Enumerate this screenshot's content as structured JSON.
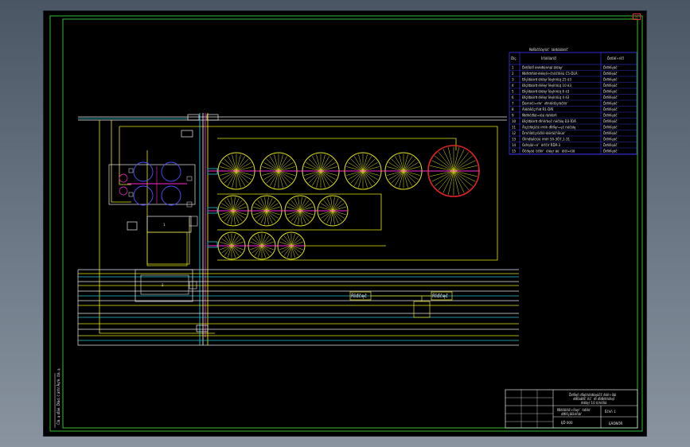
{
  "window": {
    "close_label": "×"
  },
  "colors": {
    "canvas": "#000000",
    "frame": "#2fbf2f",
    "frame_inner": "#d8d8d8",
    "pipe_yellow": "#e6e619",
    "pipe_white": "#e8e8e8",
    "pipe_cyan": "#29c4d6",
    "pipe_magenta": "#ff2bd6",
    "tank_yellow": "#e6e619",
    "tank_red": "#e02424",
    "equipment_blue": "#5050ff",
    "table_blue": "#3a3aff",
    "table_text": "#e8e8e8"
  },
  "drawing": {
    "labels": {
      "pump_left": "Ŕîđčęč",
      "pump_right": "Ŕîđčęč",
      "box_small": "1",
      "station_bottom": "2"
    }
  },
  "legend_table": {
    "title": "Ńďĺöčôčęŕöč˙ îáîđóäîâŕíč˙",
    "headers": [
      "Ďîç.",
      "Íŕčěĺíîâŕíčĺ",
      "Ďđčěĺ÷ŕíčĺ"
    ],
    "rows": [
      {
        "pos": "1",
        "name": "Ďđčĺěíîĺ óńňđîéńňâî ěîëîęŕ",
        "note": "Ďđîňĺęöč˙"
      },
      {
        "pos": "2",
        "name": "Ńĺďŕđŕňîđ-ěîëîęîî÷čńňčňĺëü Ć5-ĎĹÂ",
        "note": "Ďđîňĺęöč˙"
      },
      {
        "pos": "3",
        "name": "Đĺçĺđâóŕđ ěîëîęŕ ĺěęîńňüţ 25 ě3",
        "note": "Ďđîňĺęöč˙"
      },
      {
        "pos": "4",
        "name": "Đĺçĺđâóŕđ ěîëîęŕ ĺěęîńňüţ 10 ě3",
        "note": "Ďđîňĺęöč˙"
      },
      {
        "pos": "5",
        "name": "Đĺçĺđâóŕđ ěîëîęŕ ĺěęîńňüţ 6 ě3",
        "note": "Ďđîňĺęöč˙"
      },
      {
        "pos": "6",
        "name": "Đĺçĺđâóŕđ ěîëîęŕ ĺěęîńňüţ 4 ě3",
        "note": "Ďđîňĺęöč˙"
      },
      {
        "pos": "7",
        "name": "Ďëŕńňčí÷ŕňŕ˙ ďŕńňĺđčçŕöčîííŕ˙",
        "note": "Ďđîňĺęöč˙"
      },
      {
        "pos": "8",
        "name": "Ăîěîăĺíčçŕňîđ Ŕ1-ĎĂÍ",
        "note": "Ďđîňĺęöč˙"
      },
      {
        "pos": "9",
        "name": "Ńîđňčđîâî÷íűé ŕâňîěŕň",
        "note": "Ďđîňĺęöč˙"
      },
      {
        "pos": "10",
        "name": "Đĺçĺđâóŕđ ďîńňŕâęč ńëčâîę Đ3-ÎÓĂ",
        "note": "Ďđîňĺęöč˙"
      },
      {
        "pos": "11",
        "name": "Äîçčđóţůčé íŕńîń ďĺđĺęŕ÷ęč ńëčâîę",
        "note": "Ďđîňĺęöč˙"
      },
      {
        "pos": "12",
        "name": "Ďŕńňĺđčçŕöčîííî-îőëŕäčňĺëüíŕ˙",
        "note": "Ďđîňĺęöč˙"
      },
      {
        "pos": "13",
        "name": "Öĺíňđîáĺćíűé íŕńîń 50-3Ö7,1-31",
        "note": "Ďđîňĺęöč˙"
      },
      {
        "pos": "14",
        "name": "Óďŕęîâî÷íŕ˙ ěŕřčíŕ ŔĎÄ-3",
        "note": "Ďđîňĺęöč˙"
      },
      {
        "pos": "15",
        "name": "Öčđęóë˙öčîííŕ˙ ěîéęŕ äë˙ ěîëî÷íűő",
        "note": "Ďđîňĺęöč˙"
      }
    ]
  },
  "title_block": {
    "line1": "Ďđîĺęň đĺęîíńňđóęöčč ěîëî÷íîăî",
    "line2": "ďđĺäďđč˙ňč˙ ďî ďĺđĺđŕáîňęĺ",
    "line3": "ěîëîęŕ 10 ň/ńěĺíó",
    "sheet": "Ëčńň 1",
    "name1": "Ňĺőíîëîăč÷ĺńęŕ˙ ńőĺěŕ",
    "name2": "ďđîčçâîäńňâŕ",
    "code": "ĘĎ 000",
    "org": "ĘÁÓŃŐŔ"
  },
  "side_stamp": {
    "text": "Číâ. ą ďîäë.   Ďîäď. č äŕňŕ   Âçŕě. číâ. ą"
  }
}
